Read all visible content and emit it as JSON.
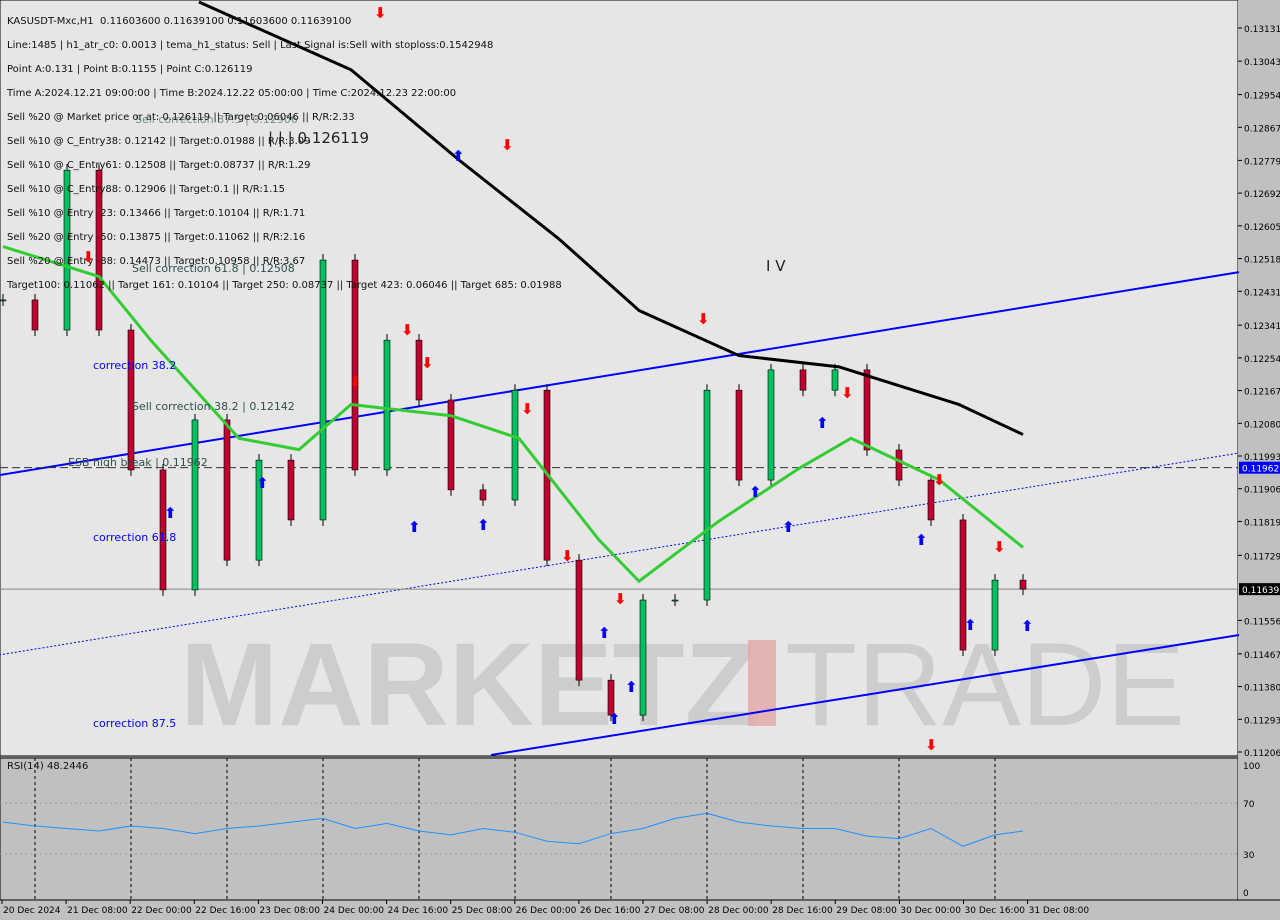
{
  "header": {
    "title_line": "KASUSDT-Mxc,H1  0.11603600 0.11639100 0.11603600 0.11639100",
    "lines": [
      "Line:1485 | h1_atr_c0: 0.0013 | tema_h1_status: Sell | Last Signal is:Sell with stoploss:0.1542948",
      "Point A:0.131 | Point B:0.1155 | Point C:0.126119",
      "Time A:2024.12.21 09:00:00 | Time B:2024.12.22 05:00:00 | Time C:2024.12.23 22:00:00",
      "Sell %20 @ Market price or at: 0.126119 || Target:0.06046 || R/R:2.33",
      "Sell %10 @ C_Entry38: 0.12142 || Target:0.01988 || R/R:3.09",
      "Sell %10 @ C_Entry61: 0.12508 || Target:0.08737 || R/R:1.29",
      "Sell %10 @ C_Entry88: 0.12906 || Target:0.1 || R/R:1.15",
      "Sell %10 @ Entry -23: 0.13466 || Target:0.10104 || R/R:1.71",
      "Sell %20 @ Entry -50: 0.13875 || Target:0.11062 || R/R:2.16",
      "Sell %20 @ Entry -88: 0.14473 || Target:0.10958 || R/R:3.67",
      "Target100: 0.11062 || Target 161: 0.10104 || Target 250: 0.08737 || Target 423: 0.06046 || Target 685: 0.01988"
    ]
  },
  "annotations": {
    "sell_corr_618": "Sell correction 61.8 | 0.12508",
    "sell_corr_382": "Sell correction 38.2 | 0.12142",
    "sell_corr_875": "Sell correction 87.5 | 0.12906",
    "corr_382": "correction 38.2",
    "corr_618": "correction 61.8",
    "corr_875": "correction 87.5",
    "esb": "ESB high break | 0.11962",
    "point_c": "| | | 0.126119",
    "wave": "I V"
  },
  "watermark": "MARKETZITRADE",
  "colors": {
    "background": "#e6e6e6",
    "bull": "#00c060",
    "bear": "#c00030",
    "ma_fast": "#33cc33",
    "ma_slow": "#000000",
    "trend": "#0000ff",
    "sell_signal": "#ff0000",
    "buy_signal": "#0000ff",
    "esb_label": "#0000ff",
    "last_label": "#000000"
  },
  "chart_data": {
    "type": "candlestick",
    "symbol": "KASUSDT-Mxc",
    "timeframe": "H1",
    "ylim": [
      0.11206,
      0.13131
    ],
    "y_ticks": [
      "0.13131",
      "0.13043",
      "0.12954",
      "0.12867",
      "0.12779",
      "0.12692",
      "0.12605",
      "0.12518",
      "0.12431",
      "0.12341",
      "0.12254",
      "0.12167",
      "0.12080",
      "0.11993",
      "0.11906",
      "0.11819",
      "0.11729",
      "0.11556",
      "0.11467",
      "0.11380",
      "0.11293",
      "0.11206"
    ],
    "x_ticks": [
      "20 Dec 2024",
      "21 Dec 08:00",
      "22 Dec 00:00",
      "22 Dec 16:00",
      "23 Dec 08:00",
      "24 Dec 00:00",
      "24 Dec 16:00",
      "25 Dec 08:00",
      "26 Dec 00:00",
      "26 Dec 16:00",
      "27 Dec 08:00",
      "28 Dec 00:00",
      "28 Dec 16:00",
      "29 Dec 08:00",
      "30 Dec 00:00",
      "30 Dec 16:00",
      "31 Dec 08:00"
    ],
    "times": [
      "2024-12-20 16:00",
      "2024-12-21 00:00",
      "2024-12-21 08:00",
      "2024-12-21 16:00",
      "2024-12-22 00:00",
      "2024-12-22 08:00",
      "2024-12-22 16:00",
      "2024-12-23 00:00",
      "2024-12-23 08:00",
      "2024-12-23 16:00",
      "2024-12-24 00:00",
      "2024-12-24 08:00",
      "2024-12-24 16:00",
      "2024-12-25 00:00",
      "2024-12-25 08:00",
      "2024-12-25 16:00",
      "2024-12-26 00:00",
      "2024-12-26 08:00",
      "2024-12-26 16:00",
      "2024-12-27 00:00",
      "2024-12-27 08:00",
      "2024-12-27 16:00",
      "2024-12-28 00:00",
      "2024-12-28 08:00",
      "2024-12-28 16:00",
      "2024-12-29 00:00",
      "2024-12-29 08:00",
      "2024-12-29 16:00",
      "2024-12-30 00:00",
      "2024-12-30 08:00",
      "2024-12-30 16:00",
      "2024-12-31 00:00",
      "2024-12-31 07:00"
    ],
    "close": [
      0.12408,
      0.12328,
      0.12753,
      0.12328,
      0.11956,
      0.11637,
      0.12089,
      0.11716,
      0.11982,
      0.11823,
      0.12514,
      0.11956,
      0.12301,
      0.12142,
      0.11903,
      0.11876,
      0.12168,
      0.11716,
      0.11397,
      0.11304,
      0.1161,
      0.1161,
      0.12168,
      0.11929,
      0.12222,
      0.12168,
      0.12222,
      0.12009,
      0.11929,
      0.11823,
      0.11477,
      0.11663,
      0.11639
    ],
    "ma_slow": {
      "times": [
        "2024-12-22 17:00",
        "2024-12-24 07:00",
        "2024-12-25 10:00",
        "2024-12-26 11:00",
        "2024-12-27 07:00",
        "2024-12-28 08:00",
        "2024-12-29 09:00",
        "2024-12-30 00:00",
        "2024-12-30 15:00",
        "2024-12-31 07:00"
      ],
      "values": [
        0.132,
        0.1302,
        0.1278,
        0.1257,
        0.1238,
        0.1226,
        0.1223,
        0.1218,
        0.1213,
        0.1205
      ]
    },
    "ma_fast": {
      "times": [
        "2024-12-20 16:00",
        "2024-12-21 16:00",
        "2024-12-22 05:00",
        "2024-12-23 03:00",
        "2024-12-23 18:00",
        "2024-12-24 07:00",
        "2024-12-25 08:00",
        "2024-12-26 01:00",
        "2024-12-26 21:00",
        "2024-12-27 07:00",
        "2024-12-28 03:00",
        "2024-12-28 23:00",
        "2024-12-29 12:00",
        "2024-12-30 10:00",
        "2024-12-31 07:00"
      ],
      "values": [
        0.1255,
        0.1247,
        0.123,
        0.1204,
        0.1201,
        0.1213,
        0.121,
        0.1204,
        0.1177,
        0.1166,
        0.1182,
        0.1196,
        0.1204,
        0.1193,
        0.1175
      ]
    },
    "trendlines": [
      {
        "style": "solid",
        "from": [
          "2024-12-20 15:00",
          0.11942
        ],
        "to": [
          "2025-01-02 13:00",
          0.12482
        ]
      },
      {
        "style": "solid",
        "from": [
          "2024-12-25 18:00",
          0.11198
        ],
        "to": [
          "2025-01-02 13:00",
          0.11517
        ]
      },
      {
        "style": "dotted",
        "from": [
          "2024-12-20 15:00",
          0.11464
        ],
        "to": [
          "2025-01-02 13:00",
          0.12001
        ]
      }
    ],
    "esb_level": 0.11962,
    "last_price": 0.11639,
    "esb_label": "0.11962",
    "last_label": "0.11639",
    "rsi": {
      "label": "RSI(14) 48.2446",
      "ylim": [
        0,
        100
      ],
      "ticks": [
        "100",
        "70",
        "30",
        "0"
      ],
      "levels": [
        70,
        30
      ],
      "values": [
        55,
        52,
        50,
        48,
        52,
        50,
        46,
        50,
        52,
        55,
        58,
        50,
        54,
        48,
        45,
        50,
        47,
        40,
        38,
        46,
        50,
        58,
        62,
        55,
        52,
        50,
        50,
        44,
        42,
        50,
        36,
        45,
        48
      ]
    }
  }
}
